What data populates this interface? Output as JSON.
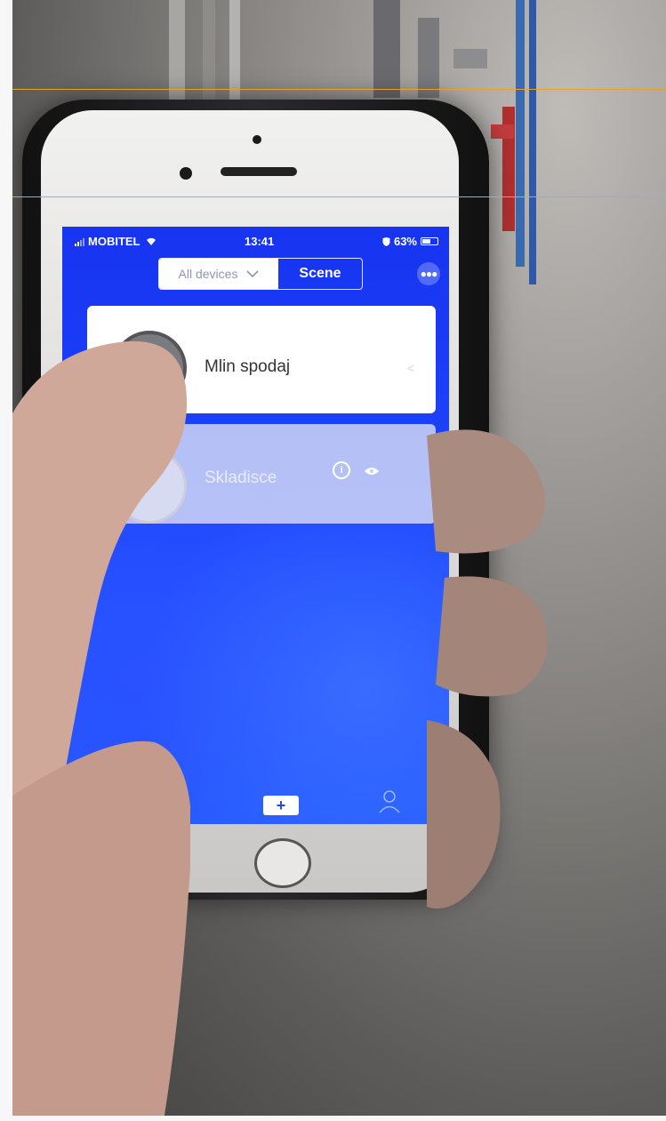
{
  "status_bar": {
    "carrier": "MOBITEL",
    "time": "13:41",
    "battery": "63%",
    "battery_level": 0.63
  },
  "header": {
    "segments": [
      {
        "label": "All devices",
        "selected": false,
        "icon": "chevron-down-icon"
      },
      {
        "label": "Scene",
        "selected": true
      }
    ],
    "more_icon": "more-dots-icon"
  },
  "scenes": [
    {
      "name": "Mlin spodaj",
      "icon": "scene-icon",
      "chevron": "<"
    },
    {
      "name": "Skladisce",
      "icon": "scene-icon",
      "badges": [
        "info-icon",
        "eye-icon"
      ],
      "info_glyph": "i"
    }
  ],
  "tab_bar": {
    "items": [
      {
        "icon": "home-grid-icon"
      },
      {
        "icon": "add-icon",
        "label": "+"
      },
      {
        "icon": "profile-icon"
      }
    ]
  },
  "colors": {
    "accent": "#1f47ff",
    "guide_line": "#e6a22a"
  }
}
